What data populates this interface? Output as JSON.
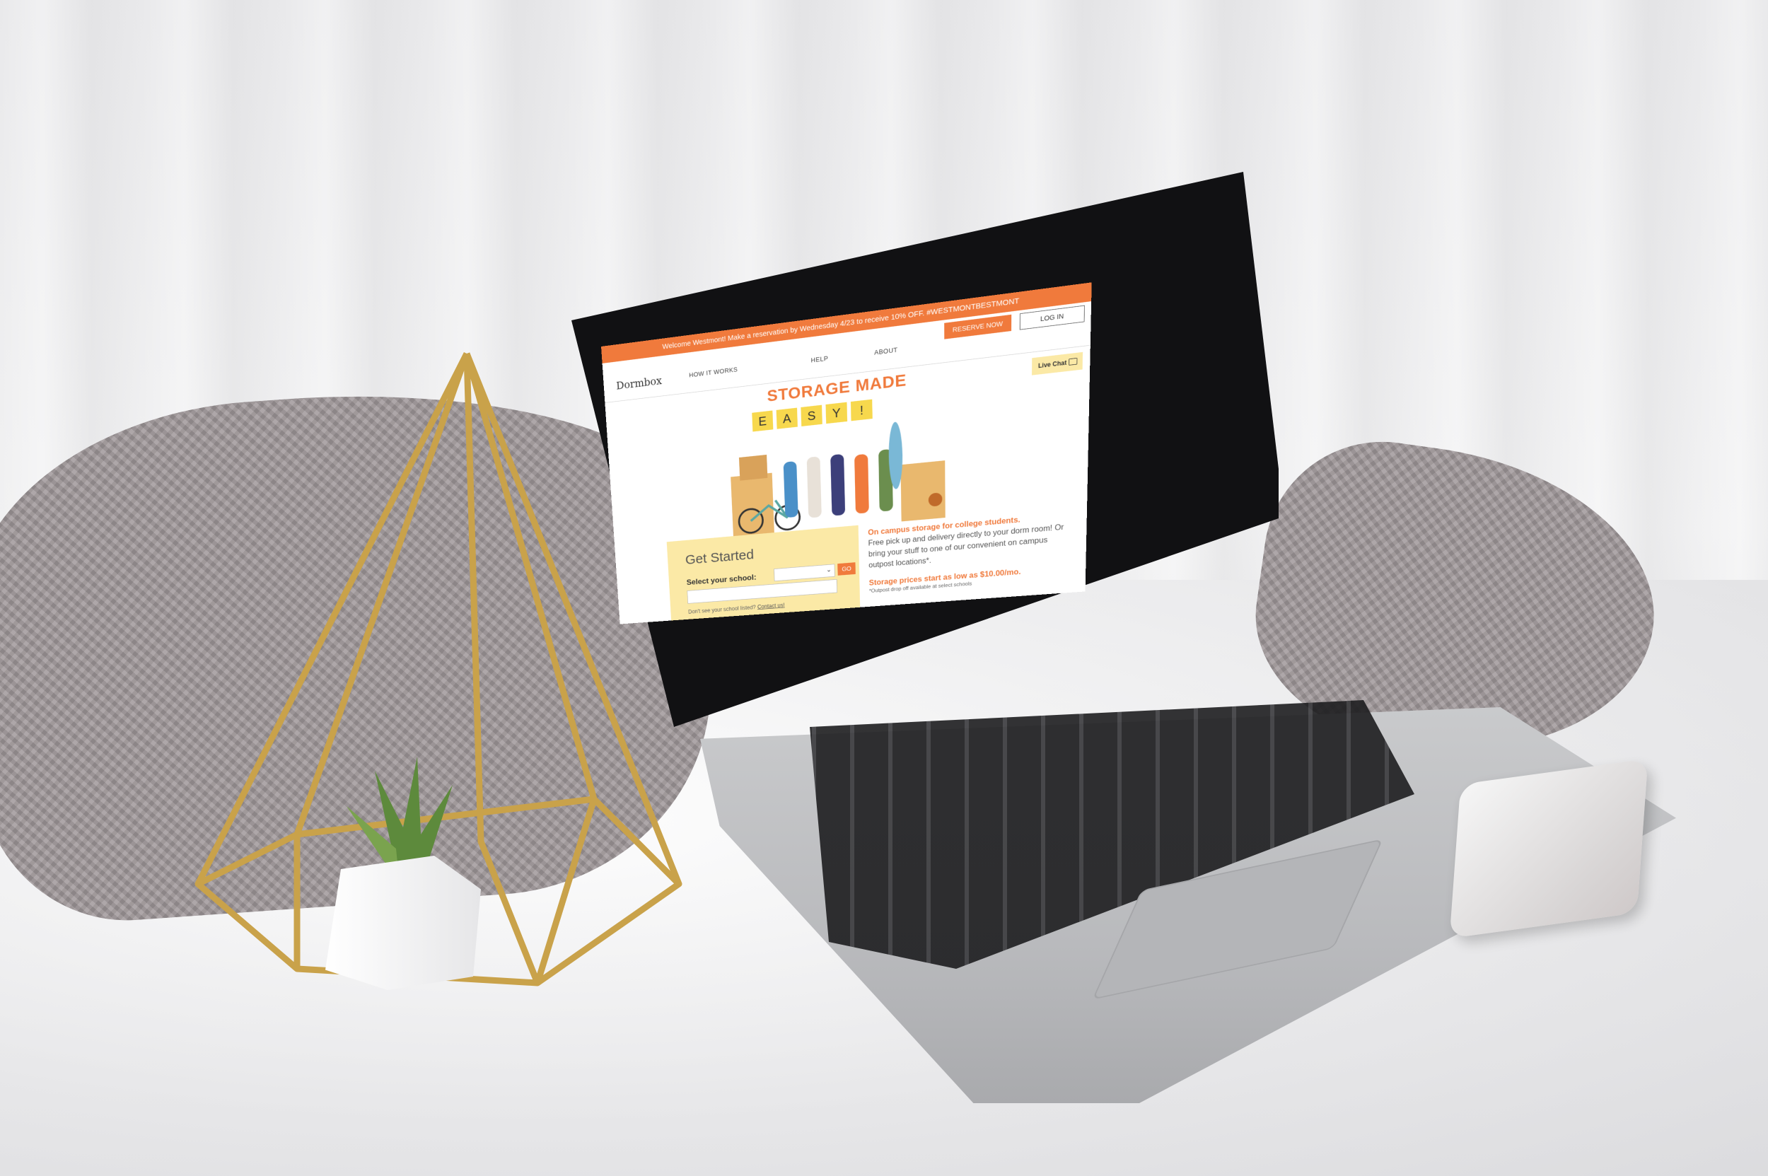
{
  "site": {
    "announcement": "Welcome Westmont! Make a reservation by Wednesday 4/23 to receive 10% OFF. #WESTMONTBESTMONT",
    "logo": "Dormbox",
    "nav": {
      "how_it_works": "HOW IT WORKS",
      "help": "HELP",
      "about": "ABOUT"
    },
    "reserve_label": "RESERVE NOW",
    "login_label": "LOG IN",
    "live_chat": "Live Chat",
    "hero": {
      "title": "STORAGE MADE",
      "easy_letters": [
        "E",
        "A",
        "S",
        "Y",
        "!"
      ]
    },
    "get_started": {
      "title": "Get Started",
      "select_label": "Select your school:",
      "go_label": "GO",
      "note_prefix": "Don't see your school listed? ",
      "contact_link": "Contact us!"
    },
    "info": {
      "lead": "On campus storage for college students.",
      "body": "Free pick up and delivery directly to your dorm room! Or bring your stuff to one of our convenient on campus outpost locations*.",
      "price": "Storage prices start as low as $10.00/mo.",
      "note": "*Outpost drop off available at select schools"
    },
    "colors": {
      "accent": "#f07a3c",
      "panel": "#fbe9a6",
      "letter_tile": "#f7d84d"
    },
    "icons": {
      "chat": "chat-bubble-icon",
      "dropdown": "chevron-down-icon"
    }
  }
}
